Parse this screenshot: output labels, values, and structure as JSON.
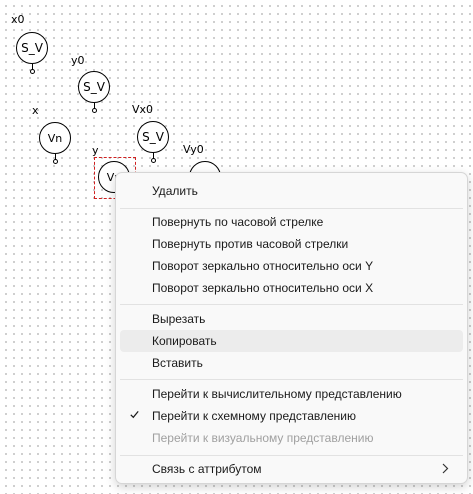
{
  "blocks": [
    {
      "id": "x0",
      "label": "x0",
      "text": "S_V"
    },
    {
      "id": "y0",
      "label": "y0",
      "text": "S_V"
    },
    {
      "id": "x",
      "label": "x",
      "text": "Vn"
    },
    {
      "id": "vx0",
      "label": "Vx0",
      "text": "S_V"
    },
    {
      "id": "y",
      "label": "y",
      "text": "Vn"
    },
    {
      "id": "vy0",
      "label": "Vy0",
      "text": "S_V"
    }
  ],
  "context_menu": {
    "delete": "Удалить",
    "rotate_cw": "Повернуть по часовой стрелке",
    "rotate_ccw": "Повернуть против часовой стрелки",
    "mirror_y": "Поворот зеркально относительно оси Y",
    "mirror_x": "Поворот зеркально относительно оси X",
    "cut": "Вырезать",
    "copy": "Копировать",
    "paste": "Вставить",
    "go_computational": "Перейти к вычислительному представлению",
    "go_schematic": "Перейти к схемному представлению",
    "go_visual": "Перейти к визуальному представлению",
    "link_attribute": "Связь с аттрибутом"
  }
}
